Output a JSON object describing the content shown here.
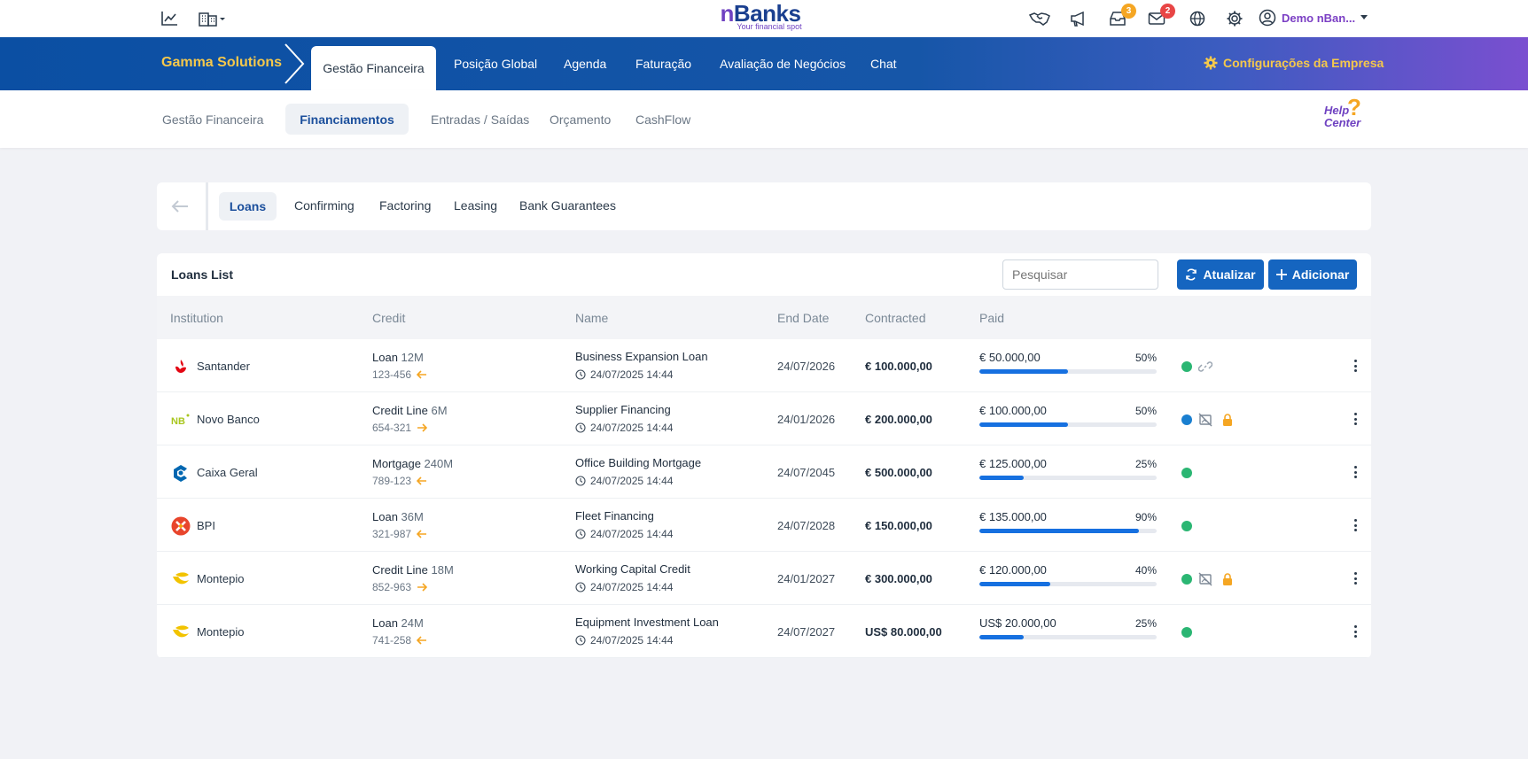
{
  "topbar": {
    "brand": "Banks",
    "brand_initial": "n",
    "tagline": "Your financial spot",
    "notifications_count": "3",
    "messages_count": "2",
    "user_name": "Demo nBan...",
    "accent": "#6f42c1"
  },
  "navbar": {
    "company": "Gamma Solutions",
    "active": "Gestão Financeira",
    "items": [
      "Posição Global",
      "Agenda",
      "Faturação",
      "Avaliação de Negócios",
      "Chat"
    ],
    "config": "Configurações da Empresa"
  },
  "subnav": {
    "items": [
      "Gestão Financeira",
      "Entradas / Saídas",
      "Orçamento",
      "CashFlow"
    ],
    "active": "Financiamentos",
    "help_line1": "Help",
    "help_line2": "Center"
  },
  "tabs": {
    "active": "Loans",
    "items": [
      "Confirming",
      "Factoring",
      "Leasing",
      "Bank Guarantees"
    ]
  },
  "list": {
    "title": "Loans List",
    "search_placeholder": "Pesquisar",
    "refresh_label": "Atualizar",
    "add_label": "Adicionar",
    "columns": [
      "Institution",
      "Credit",
      "Name",
      "End Date",
      "Contracted",
      "Paid"
    ],
    "rows": [
      {
        "institution": "Santander",
        "credit_type": "Loan",
        "credit_amount": "12M",
        "ref": "123-456",
        "direction": "left",
        "name": "Business Expansion Loan",
        "created": "24/07/2025 14:44",
        "end_date": "24/07/2026",
        "contracted": "€ 100.000,00",
        "paid": "€ 50.000,00",
        "pct_label": "50%",
        "pct": 50,
        "status_color": "#2bb673",
        "icons": [
          "link-icon"
        ]
      },
      {
        "institution": "Novo Banco",
        "credit_type": "Credit Line",
        "credit_amount": "6M",
        "ref": "654-321",
        "direction": "right",
        "name": "Supplier Financing",
        "created": "24/07/2025 14:44",
        "end_date": "24/01/2026",
        "contracted": "€ 200.000,00",
        "paid": "€ 100.000,00",
        "pct_label": "50%",
        "pct": 50,
        "status_color": "#1a7fd0",
        "icons": [
          "no-image-icon",
          "lock-icon"
        ]
      },
      {
        "institution": "Caixa Geral",
        "credit_type": "Mortgage",
        "credit_amount": "240M",
        "ref": "789-123",
        "direction": "left",
        "name": "Office Building Mortgage",
        "created": "24/07/2025 14:44",
        "end_date": "24/07/2045",
        "contracted": "€ 500.000,00",
        "paid": "€ 125.000,00",
        "pct_label": "25%",
        "pct": 25,
        "status_color": "#2bb673",
        "icons": []
      },
      {
        "institution": "BPI",
        "credit_type": "Loan",
        "credit_amount": "36M",
        "ref": "321-987",
        "direction": "left",
        "name": "Fleet Financing",
        "created": "24/07/2025 14:44",
        "end_date": "24/07/2028",
        "contracted": "€ 150.000,00",
        "paid": "€ 135.000,00",
        "pct_label": "90%",
        "pct": 90,
        "status_color": "#2bb673",
        "icons": []
      },
      {
        "institution": "Montepio",
        "credit_type": "Credit Line",
        "credit_amount": "18M",
        "ref": "852-963",
        "direction": "right",
        "name": "Working Capital Credit",
        "created": "24/07/2025 14:44",
        "end_date": "24/01/2027",
        "contracted": "€ 300.000,00",
        "paid": "€ 120.000,00",
        "pct_label": "40%",
        "pct": 40,
        "status_color": "#2bb673",
        "icons": [
          "no-image-icon",
          "lock-icon"
        ]
      },
      {
        "institution": "Montepio",
        "credit_type": "Loan",
        "credit_amount": "24M",
        "ref": "741-258",
        "direction": "left",
        "name": "Equipment Investment Loan",
        "created": "24/07/2025 14:44",
        "end_date": "24/07/2027",
        "contracted": "US$ 80.000,00",
        "paid": "US$ 20.000,00",
        "pct_label": "25%",
        "pct": 25,
        "status_color": "#2bb673",
        "icons": []
      }
    ]
  }
}
